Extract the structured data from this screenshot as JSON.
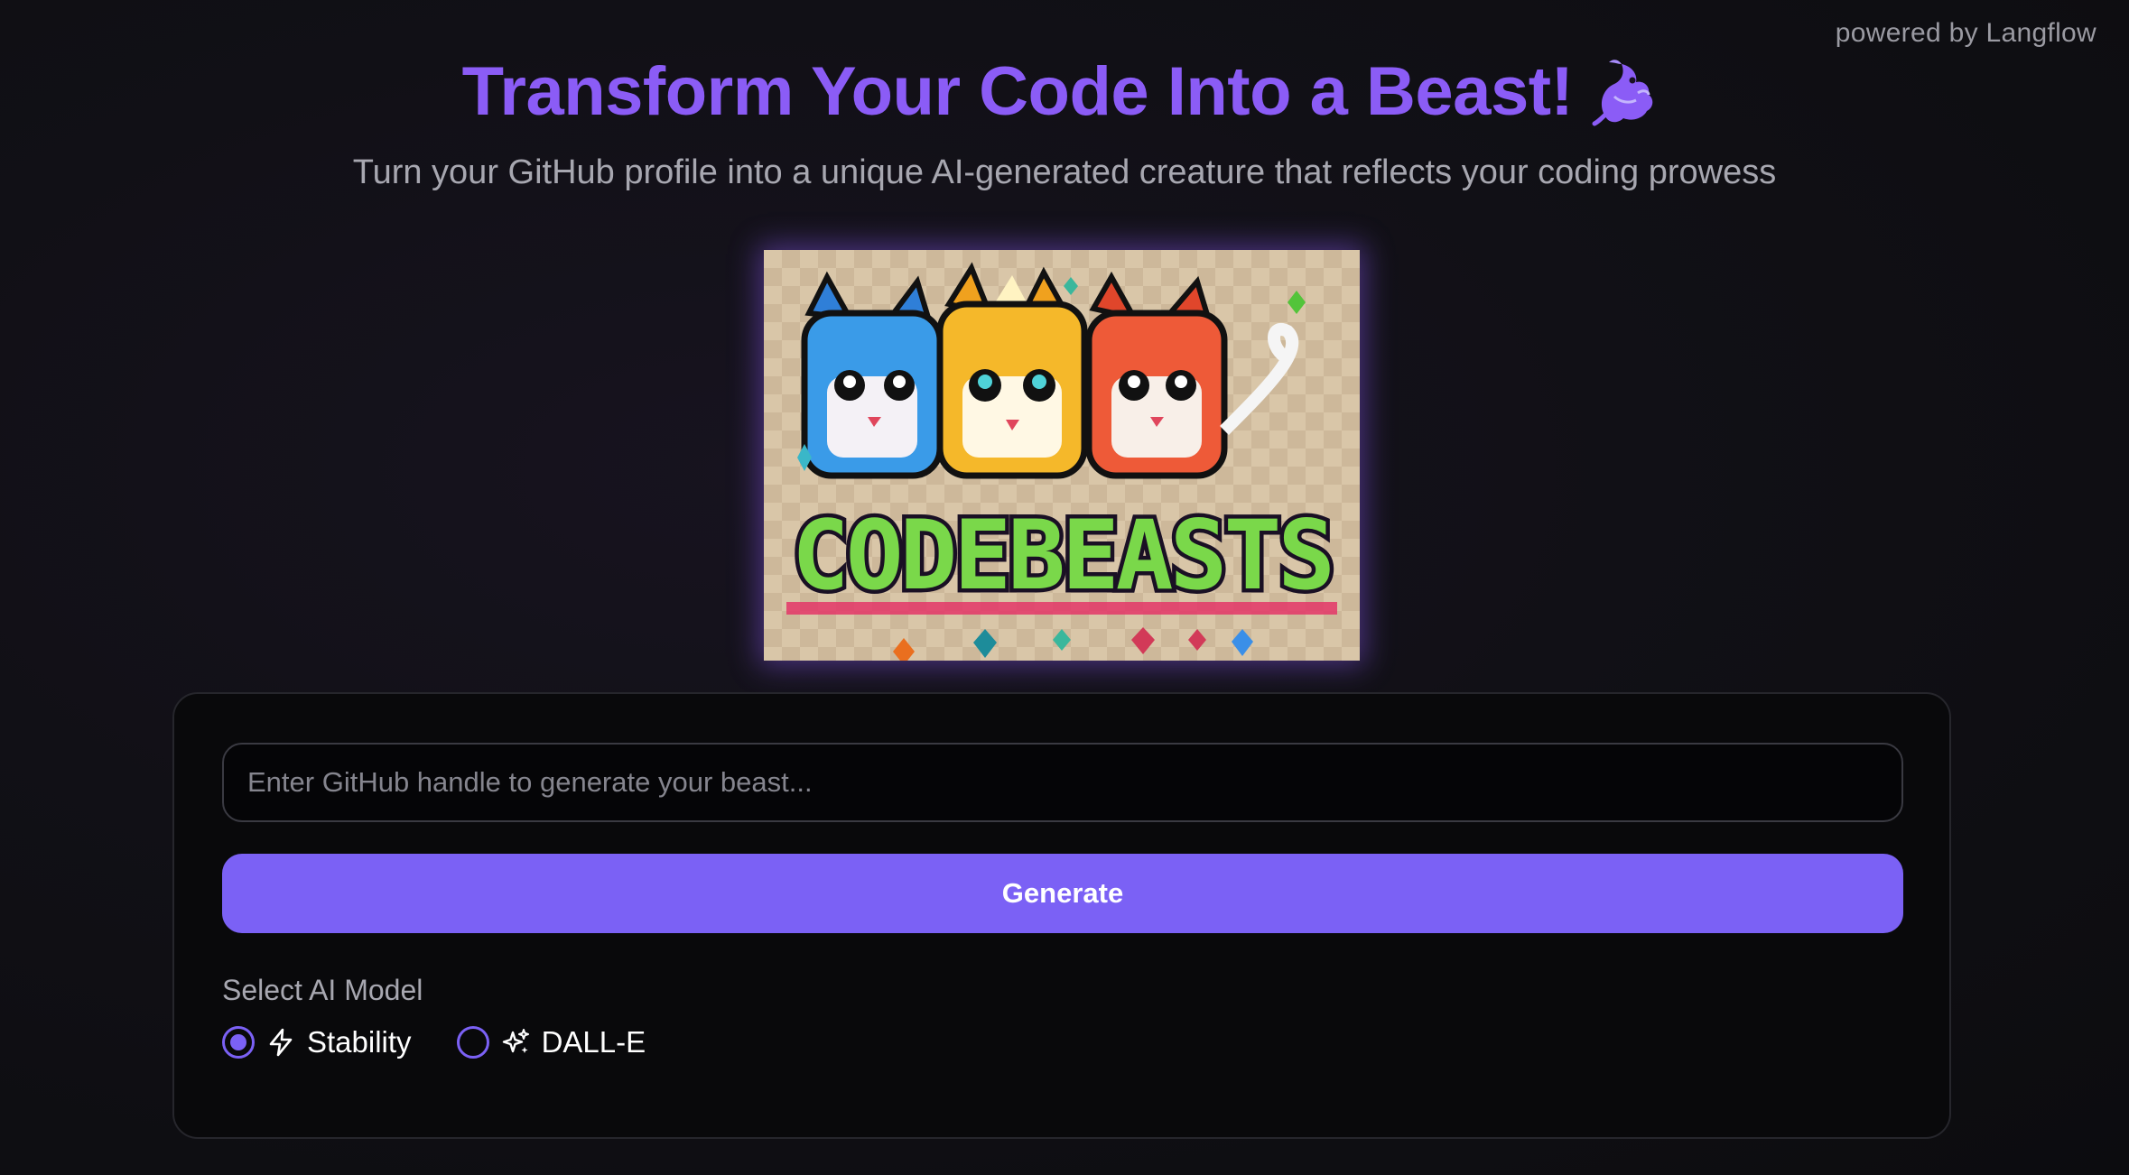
{
  "header": {
    "powered_by": "powered by Langflow",
    "title": "Transform Your Code Into a Beast!",
    "title_icon": "dragon-icon",
    "subtitle": "Turn your GitHub profile into a unique AI-generated creature that reflects your coding prowess"
  },
  "hero_image": {
    "text": "CODEBEASTS"
  },
  "form": {
    "input_placeholder": "Enter GitHub handle to generate your beast...",
    "input_value": "",
    "generate_label": "Generate",
    "model_label": "Select AI Model",
    "models": [
      {
        "label": "Stability",
        "icon": "lightning-icon",
        "selected": true
      },
      {
        "label": "DALL-E",
        "icon": "sparkles-icon",
        "selected": false
      }
    ]
  },
  "colors": {
    "accent": "#7b61f5",
    "title": "#8b5cf6",
    "background": "#111016"
  }
}
